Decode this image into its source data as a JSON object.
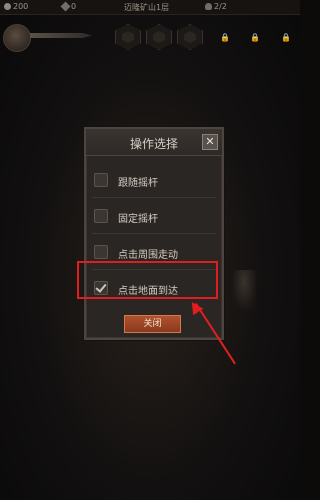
{
  "topbar": {
    "coins": "200",
    "gems": "0",
    "location": "迈隆矿山1层",
    "souls": "2/2"
  },
  "hud": {
    "lock_symbol": "🔒"
  },
  "dialog": {
    "title": "操作选择",
    "close_symbol": "✕",
    "options": [
      {
        "label": "跟随摇杆",
        "checked": false
      },
      {
        "label": "固定摇杆",
        "checked": false
      },
      {
        "label": "点击周围走动",
        "checked": false
      },
      {
        "label": "点击地面到达",
        "checked": true
      }
    ],
    "close_button": "关闭"
  },
  "annotation": {
    "color": "#e01e1e"
  }
}
